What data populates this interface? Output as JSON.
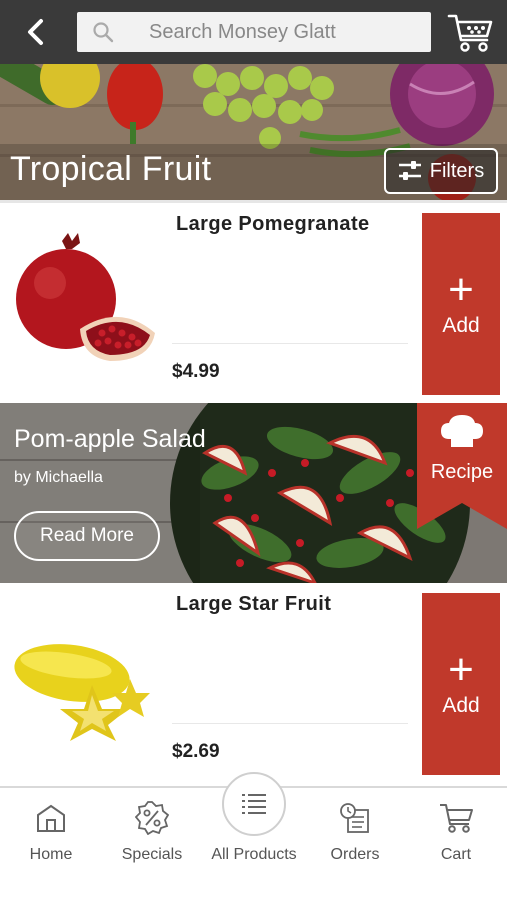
{
  "header": {
    "back_icon": "chevron-left-icon",
    "search_placeholder": "Search Monsey Glatt",
    "cart_icon": "cart-icon"
  },
  "category": {
    "title": "Tropical Fruit",
    "filters_label": "Filters",
    "filters_icon": "sliders-icon"
  },
  "products": [
    {
      "name": "Large Pomegranate",
      "price": "$4.99",
      "add_label": "Add",
      "add_symbol": "+"
    },
    {
      "name": "Large Star Fruit",
      "price": "$2.69",
      "add_label": "Add",
      "add_symbol": "+"
    }
  ],
  "recipe": {
    "title": "Pom-apple Salad",
    "author": "by Michaella",
    "read_more_label": "Read More",
    "tag_label": "Recipe",
    "tag_icon": "chef-hat-icon"
  },
  "bottom_nav": [
    {
      "label": "Home",
      "icon": "home-icon"
    },
    {
      "label": "Specials",
      "icon": "percent-badge-icon"
    },
    {
      "label": "All Products",
      "icon": "list-icon"
    },
    {
      "label": "Orders",
      "icon": "orders-icon"
    },
    {
      "label": "Cart",
      "icon": "cart-icon"
    }
  ],
  "colors": {
    "topbar": "#3a3a3a",
    "accent_red": "#c0392b",
    "nav_text": "#555555"
  }
}
